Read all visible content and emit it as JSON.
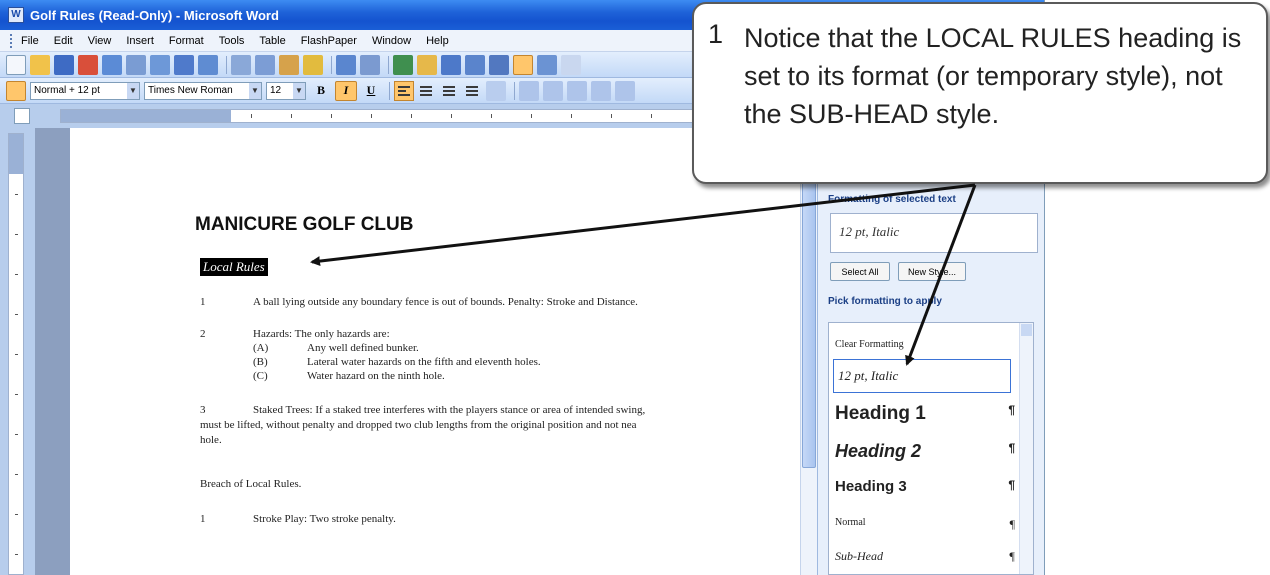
{
  "window": {
    "title": "Golf Rules (Read-Only) - Microsoft Word",
    "app_icon": "W"
  },
  "menu": [
    "File",
    "Edit",
    "View",
    "Insert",
    "Format",
    "Tools",
    "Table",
    "FlashPaper",
    "Window",
    "Help"
  ],
  "format_toolbar": {
    "style_value": "Normal + 12 pt",
    "font_value": "Times New Roman",
    "size_value": "12",
    "bold_label": "B",
    "italic_label": "I",
    "underline_label": "U"
  },
  "document": {
    "title": "MANICURE GOLF CLUB",
    "selected_heading": "Local Rules",
    "rule1_num": "1",
    "rule1_text": "A ball lying outside any boundary fence is out of bounds. Penalty: Stroke and Distance.",
    "rule2_num": "2",
    "rule2_text": "Hazards:  The only hazards are:",
    "rule2_a_label": "(A)",
    "rule2_a_text": "Any well defined bunker.",
    "rule2_b_label": "(B)",
    "rule2_b_text": "Lateral water hazards on the fifth and eleventh holes.",
    "rule2_c_label": "(C)",
    "rule2_c_text": "Water hazard on the ninth hole.",
    "rule3_num": "3",
    "rule3_line1": "Staked Trees:  If a staked tree interferes with the players stance or area of intended swing,",
    "rule3_line2": "must be lifted, without penalty and dropped two club lengths from the original position and not nea",
    "rule3_line3": "hole.",
    "breach_heading": "Breach of Local Rules.",
    "breach1_num": "1",
    "breach1_text": "Stroke Play:  Two stroke penalty."
  },
  "task_pane": {
    "formatting_label": "Formatting of selected text",
    "selected_format": "12 pt, Italic",
    "select_all": "Select All",
    "new_style": "New Style...",
    "pick_label": "Pick formatting to apply",
    "items": {
      "clear": "Clear Formatting",
      "current": "12 pt, Italic",
      "h1": "Heading 1",
      "h2": "Heading 2",
      "h3": "Heading 3",
      "normal": "Normal",
      "subhead": "Sub-Head"
    },
    "pilcrow": "¶"
  },
  "callout": {
    "number": "1",
    "text": "Notice that the LOCAL RULES heading is set to its format (or temporary style), not the SUB-HEAD style."
  },
  "colors": {
    "titlebar": "#1f63d9",
    "selection_highlight": "#000000",
    "active_button": "#ffc66b"
  }
}
